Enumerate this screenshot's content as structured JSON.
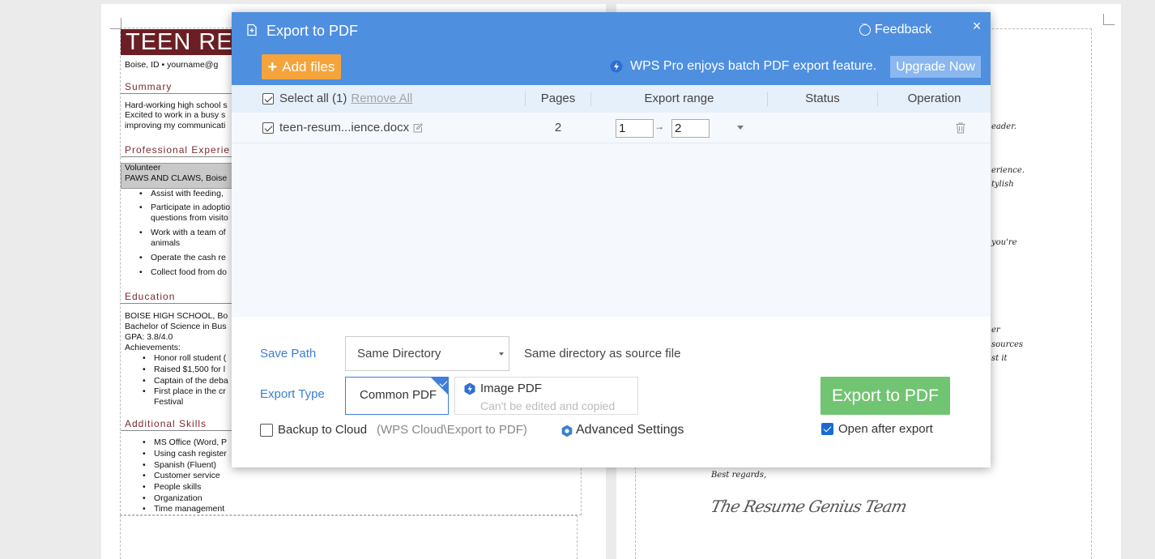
{
  "document": {
    "resume_title": "TEEN RES",
    "contact": "Boise, ID  •  yourname@g",
    "sections": {
      "summary": "Summary",
      "experience": "Professional Experie",
      "education": "Education",
      "skills": "Additional Skills"
    },
    "summary_lines": [
      "Hard-working high school s",
      "Excited to work in a busy s",
      "improving my communicati"
    ],
    "experience_role": "Volunteer",
    "experience_org": "PAWS AND CLAWS, Boise",
    "experience_bullets": [
      "Assist with feeding,",
      "Participate in adoptio",
      "questions from visito",
      "Work with a team of",
      "animals",
      "Operate the cash re",
      "Collect food from do"
    ],
    "education_lines": [
      "BOISE HIGH SCHOOL, Bo",
      "Bachelor of Science in Bus",
      "GPA: 3.8/4.0",
      "Achievements:"
    ],
    "education_bullets": [
      "Honor roll student (",
      "Raised $1,500 for l",
      "Captain of the deba",
      "First place in the cr",
      "Festival"
    ],
    "skills_bullets": [
      "MS Office (Word, P",
      "Using cash register",
      "Spanish (Fluent)",
      "Customer service",
      "People skills",
      "Organization",
      "Time management"
    ],
    "letter_fragments": [
      "eader.",
      "erience.",
      "tylish",
      "you're",
      "er",
      "sources",
      "st it"
    ],
    "letter_closing": "Best regards,",
    "letter_signature": "The Resume Genius Team"
  },
  "dialog": {
    "title": "Export to PDF",
    "feedback": "Feedback",
    "close": "×",
    "add_files": "Add files",
    "add_files_plus": "+",
    "pro_text": "WPS Pro enjoys batch PDF export feature.",
    "upgrade": "Upgrade Now",
    "table": {
      "select_all": "Select all (1)",
      "remove_all": "Remove All",
      "col_pages": "Pages",
      "col_range": "Export range",
      "col_status": "Status",
      "col_operation": "Operation",
      "rows": [
        {
          "filename": "teen-resum...ience.docx",
          "pages": "2",
          "range_from": "1",
          "range_to": "2",
          "status": ""
        }
      ],
      "range_arrow": "→"
    },
    "save_path_label": "Save Path",
    "save_path_value": "Same Directory",
    "save_path_desc": "Same directory as source file",
    "export_type_label": "Export Type",
    "type_common": "Common PDF",
    "type_image": "Image PDF",
    "type_image_sub": "Can't be edited and copied",
    "backup_label": "Backup to Cloud",
    "backup_path": "(WPS Cloud\\Export to PDF)",
    "advanced": "Advanced Settings",
    "export_button": "Export to PDF",
    "open_after": "Open after export"
  },
  "colors": {
    "header_blue": "#4f8fe0",
    "add_files_orange": "#f4a43b",
    "export_green": "#71c472",
    "link_blue": "#3b7fd1"
  }
}
